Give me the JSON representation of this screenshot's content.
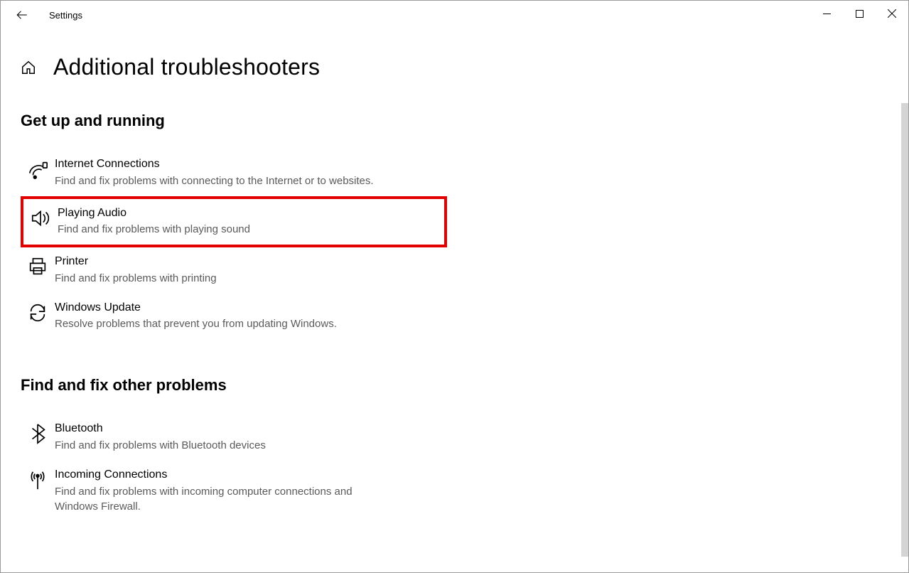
{
  "titlebar": {
    "app_name": "Settings"
  },
  "page": {
    "title": "Additional troubleshooters"
  },
  "section1": {
    "title": "Get up and running",
    "items": [
      {
        "title": "Internet Connections",
        "desc": "Find and fix problems with connecting to the Internet or to websites."
      },
      {
        "title": "Playing Audio",
        "desc": "Find and fix problems with playing sound"
      },
      {
        "title": "Printer",
        "desc": "Find and fix problems with printing"
      },
      {
        "title": "Windows Update",
        "desc": "Resolve problems that prevent you from updating Windows."
      }
    ]
  },
  "section2": {
    "title": "Find and fix other problems",
    "items": [
      {
        "title": "Bluetooth",
        "desc": "Find and fix problems with Bluetooth devices"
      },
      {
        "title": "Incoming Connections",
        "desc": "Find and fix problems with incoming computer connections and Windows Firewall."
      }
    ]
  },
  "annotation": {
    "highlighted_item": "Playing Audio"
  }
}
